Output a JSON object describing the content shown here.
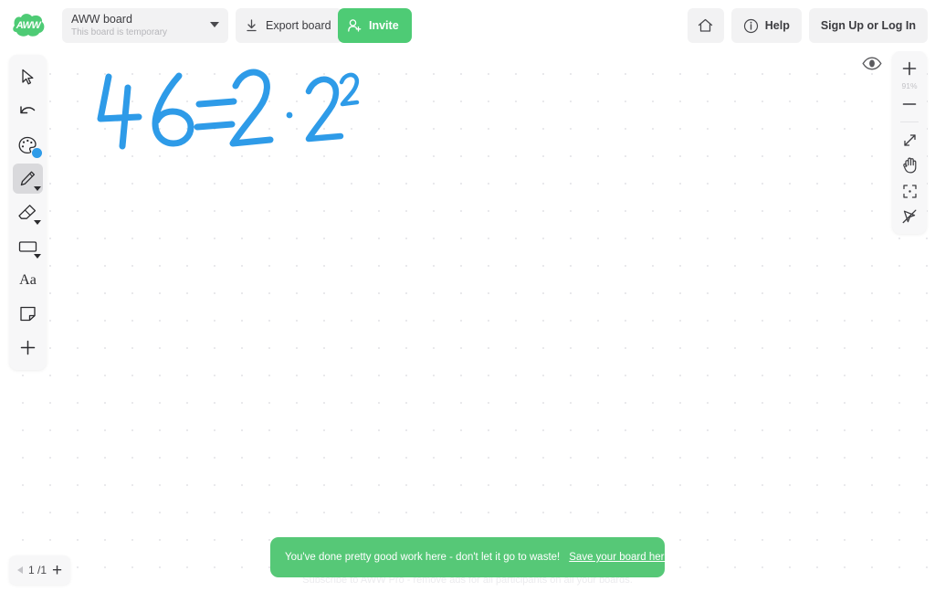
{
  "header": {
    "logo_text": "AWW",
    "logo_name": "aww-logo",
    "board": {
      "title": "AWW board",
      "subtitle": "This board is temporary",
      "caret_icon": "chevron-down-icon"
    },
    "export_label": "Export board",
    "export_icon": "download-icon",
    "invite_label": "Invite",
    "invite_icon": "person-add-icon",
    "home_icon": "home-icon",
    "help_label": "Help",
    "help_icon": "info-circle-icon",
    "signup_label": "Sign Up or Log In"
  },
  "toolbar": {
    "items": [
      {
        "name": "select-tool",
        "icon": "cursor-icon",
        "active": false
      },
      {
        "name": "undo-tool",
        "icon": "undo-arrow-icon",
        "active": false
      },
      {
        "name": "color-palette-tool",
        "icon": "palette-icon",
        "active": false
      },
      {
        "name": "pencil-tool",
        "icon": "pencil-icon",
        "active": true
      },
      {
        "name": "eraser-tool",
        "icon": "eraser-icon",
        "active": false
      },
      {
        "name": "shape-tool",
        "icon": "rectangle-icon",
        "active": false
      },
      {
        "name": "text-tool",
        "icon": "text-aa-icon",
        "active": false
      },
      {
        "name": "sticky-note-tool",
        "icon": "sticky-note-icon",
        "active": false
      },
      {
        "name": "add-tool",
        "icon": "plus-icon",
        "active": false
      }
    ],
    "text_glyph": "Aa",
    "current_color": "#2E9BE8"
  },
  "rail": {
    "zoom_in_icon": "plus-icon",
    "zoom_level": "91%",
    "zoom_out_icon": "minus-icon",
    "expand_icon": "expand-arrows-icon",
    "pan_icon": "hand-icon",
    "focus_icon": "focus-brackets-icon",
    "laser_icon": "laser-pointer-icon",
    "presence_icon": "eye-icon"
  },
  "canvas": {
    "ink_color": "#2E9BE8",
    "drawing_description": "46 = 2 · 2²"
  },
  "footer": {
    "pager": {
      "prev_icon": "triangle-left-icon",
      "count": "1 /1",
      "add_icon": "plus-icon"
    },
    "ad_text": "Subscribe to AWW Pro - remove ads for all participants on all your boards.",
    "toast": {
      "message": "You've done pretty good work here - don't let it go to waste!",
      "link": "Save your board here.",
      "close_icon": "close-icon",
      "color": "#56C877"
    }
  }
}
